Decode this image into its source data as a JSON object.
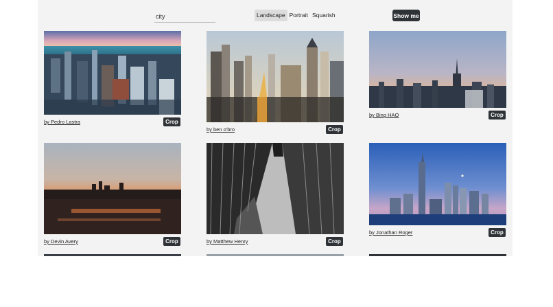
{
  "search": {
    "value": "city",
    "placeholder": "city"
  },
  "orientation": {
    "landscape": "Landscape",
    "portrait": "Portrait",
    "squarish": "Squarish",
    "selected": "Landscape"
  },
  "submit_label": "Show me",
  "crop_label": "Crop",
  "photos": [
    {
      "author": "by Pedro Lastra"
    },
    {
      "author": "by ben o'bro"
    },
    {
      "author": "by Bing HAO"
    },
    {
      "author": "by Devin Avery"
    },
    {
      "author": "by Matthew Henry"
    },
    {
      "author": "by Jonathan Roger"
    }
  ],
  "colors": {
    "panel_bg": "#f3f3f3",
    "button_dark": "#2f3337",
    "toggle_active": "#dcdcdc"
  }
}
